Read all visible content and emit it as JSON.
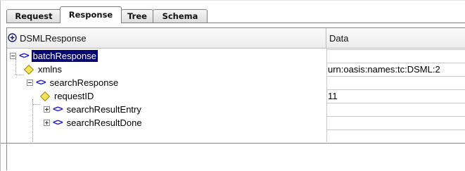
{
  "tabs": [
    {
      "label": "Request",
      "active": false
    },
    {
      "label": "Response",
      "active": true
    },
    {
      "label": "Tree",
      "active": false
    },
    {
      "label": "Schema",
      "active": false
    }
  ],
  "table": {
    "columns": {
      "tree": "DSMLResponse",
      "data": "Data"
    },
    "header_icon": "plus-circle-icon",
    "rows": [
      {
        "name": "batchResponse",
        "kind": "element",
        "icon": "element-brackets-icon",
        "expander": "expanded",
        "selected": true,
        "data": ""
      },
      {
        "name": "xmlns",
        "kind": "attribute",
        "icon": "attribute-diamond-icon",
        "expander": "none",
        "selected": false,
        "data": "urn:oasis:names:tc:DSML:2"
      },
      {
        "name": "searchResponse",
        "kind": "element",
        "icon": "element-brackets-icon",
        "expander": "expanded",
        "selected": false,
        "data": ""
      },
      {
        "name": "requestID",
        "kind": "attribute",
        "icon": "attribute-diamond-icon",
        "expander": "none",
        "selected": false,
        "data": "11"
      },
      {
        "name": "searchResultEntry",
        "kind": "element",
        "icon": "element-brackets-icon",
        "expander": "collapsed",
        "selected": false,
        "data": ""
      },
      {
        "name": "searchResultDone",
        "kind": "element",
        "icon": "element-brackets-icon",
        "expander": "collapsed",
        "selected": false,
        "data": ""
      }
    ]
  },
  "colors": {
    "selection": "#07076f",
    "element_icon": "#1f1fc8",
    "attribute_icon": "#f3e25a"
  }
}
